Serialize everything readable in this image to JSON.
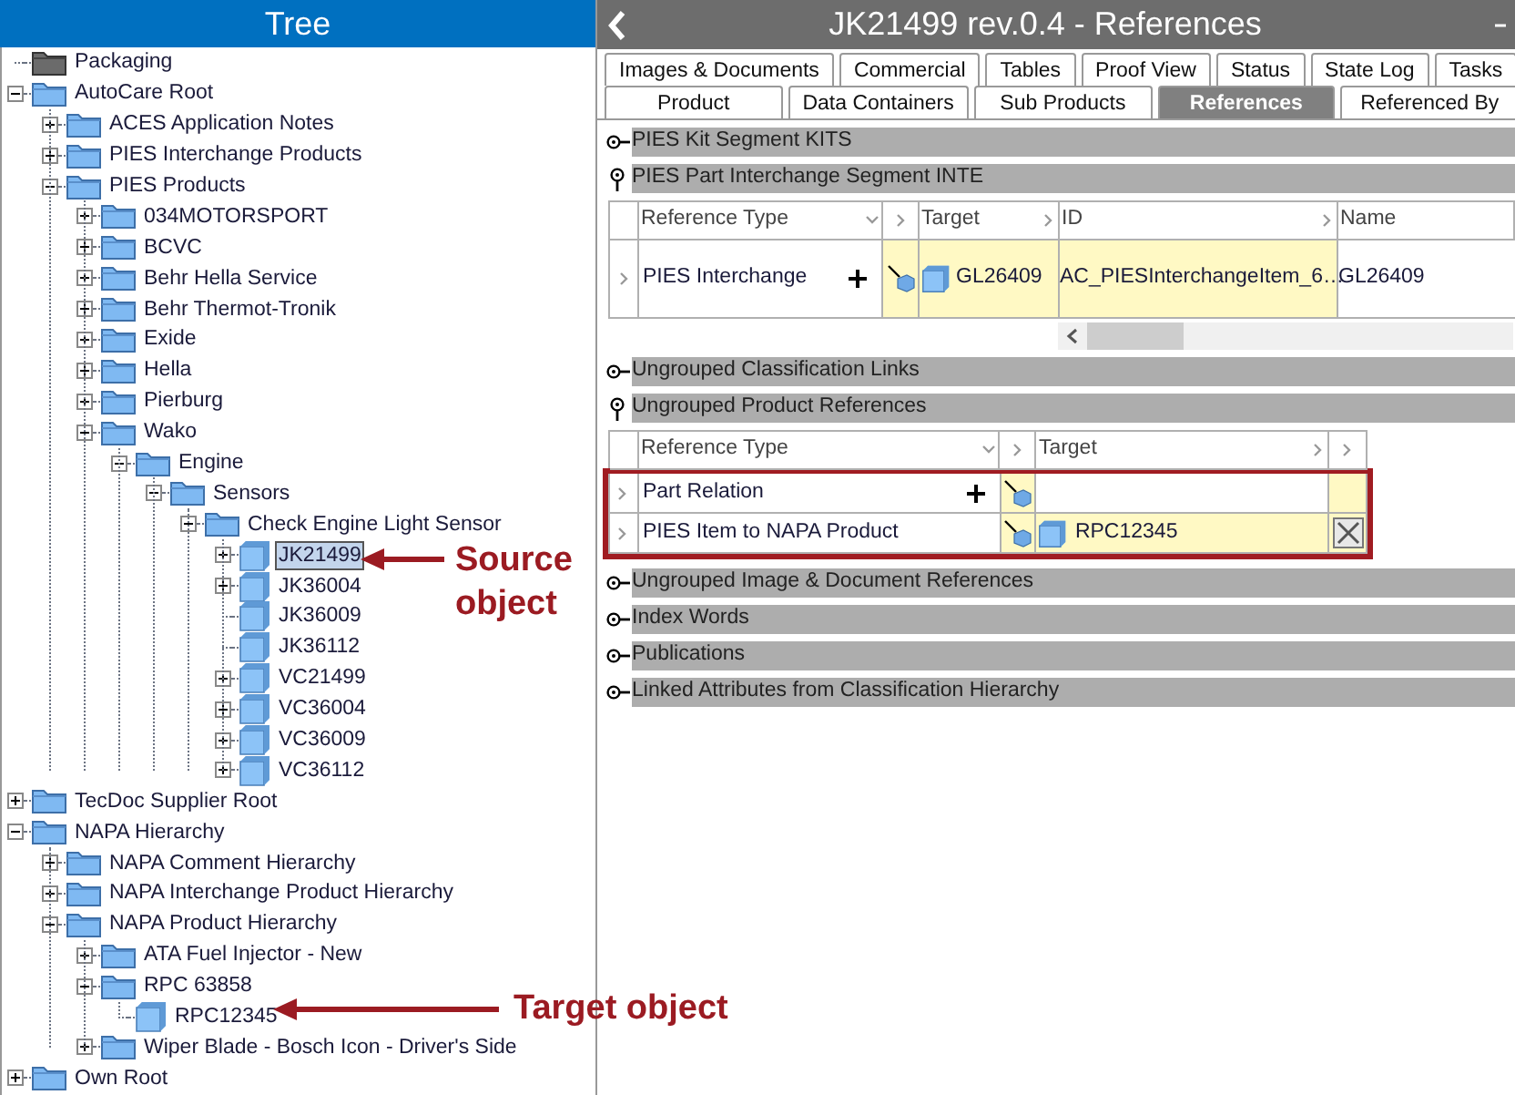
{
  "tree": {
    "title": "Tree",
    "items": [
      {
        "label": "Packaging",
        "kind": "folder-dark"
      },
      {
        "label": "AutoCare Root",
        "kind": "folder",
        "expanded": true,
        "children": [
          {
            "label": "ACES Application Notes",
            "kind": "folder",
            "expanded": false
          },
          {
            "label": "PIES Interchange Products",
            "kind": "folder",
            "expanded": false
          },
          {
            "label": "PIES Products",
            "kind": "folder",
            "expanded": true,
            "children": [
              {
                "label": "034MOTORSPORT",
                "kind": "folder",
                "expanded": false
              },
              {
                "label": "BCVC",
                "kind": "folder",
                "expanded": false
              },
              {
                "label": "Behr Hella Service",
                "kind": "folder",
                "expanded": false
              },
              {
                "label": "Behr Thermot-Tronik",
                "kind": "folder",
                "expanded": false
              },
              {
                "label": "Exide",
                "kind": "folder",
                "expanded": false
              },
              {
                "label": "Hella",
                "kind": "folder",
                "expanded": false
              },
              {
                "label": "Pierburg",
                "kind": "folder",
                "expanded": false
              },
              {
                "label": "Wako",
                "kind": "folder",
                "expanded": true,
                "children": [
                  {
                    "label": "Engine",
                    "kind": "folder",
                    "expanded": true,
                    "children": [
                      {
                        "label": "Sensors",
                        "kind": "folder",
                        "expanded": true,
                        "children": [
                          {
                            "label": "Check Engine Light Sensor",
                            "kind": "folder",
                            "expanded": true,
                            "children": [
                              {
                                "label": "JK21499",
                                "kind": "product",
                                "expanded": false,
                                "selected": true
                              },
                              {
                                "label": "JK36004",
                                "kind": "product",
                                "expanded": false,
                                "selected": false
                              },
                              {
                                "label": "JK36009",
                                "kind": "product",
                                "selected": false
                              },
                              {
                                "label": "JK36112",
                                "kind": "product",
                                "selected": false
                              },
                              {
                                "label": "VC21499",
                                "kind": "product",
                                "expanded": false,
                                "selected": false
                              },
                              {
                                "label": "VC36004",
                                "kind": "product",
                                "expanded": false,
                                "selected": false
                              },
                              {
                                "label": "VC36009",
                                "kind": "product",
                                "expanded": false,
                                "selected": false
                              },
                              {
                                "label": "VC36112",
                                "kind": "product",
                                "expanded": false,
                                "selected": false
                              }
                            ]
                          }
                        ]
                      }
                    ]
                  }
                ]
              }
            ]
          }
        ]
      },
      {
        "label": "TecDoc Supplier Root",
        "kind": "folder",
        "expanded": false
      },
      {
        "label": "NAPA Hierarchy",
        "kind": "folder",
        "expanded": true,
        "children": [
          {
            "label": "NAPA Comment Hierarchy",
            "kind": "folder",
            "expanded": false
          },
          {
            "label": "NAPA Interchange Product Hierarchy",
            "kind": "folder",
            "expanded": false
          },
          {
            "label": "NAPA Product Hierarchy",
            "kind": "folder",
            "expanded": true,
            "children": [
              {
                "label": "ATA Fuel Injector - New",
                "kind": "folder",
                "expanded": false
              },
              {
                "label": "RPC 63858",
                "kind": "folder",
                "expanded": true,
                "children": [
                  {
                    "label": "RPC12345",
                    "kind": "product",
                    "selected": false
                  }
                ]
              },
              {
                "label": "Wiper Blade - Bosch Icon - Driver's Side",
                "kind": "folder",
                "expanded": false
              }
            ]
          }
        ]
      },
      {
        "label": "Own Root",
        "kind": "folder",
        "expanded": false
      }
    ]
  },
  "annotations": [
    {
      "line1": "Source",
      "line2": "object",
      "kind": "source"
    },
    {
      "line1": "Target object",
      "kind": "target"
    }
  ],
  "editor": {
    "title": "JK21499 rev.0.4 - References",
    "tab_rows": [
      [
        {
          "label": "Images & Documents",
          "selected": false
        },
        {
          "label": "Commercial",
          "selected": false
        },
        {
          "label": "Tables",
          "selected": false
        },
        {
          "label": "Proof View",
          "selected": false
        },
        {
          "label": "Status",
          "selected": false
        },
        {
          "label": "State Log",
          "selected": false
        },
        {
          "label": "Tasks",
          "selected": false
        }
      ],
      [
        {
          "label": "Product",
          "selected": false
        },
        {
          "label": "Data Containers",
          "selected": false
        },
        {
          "label": "Sub Products",
          "selected": false
        },
        {
          "label": "References",
          "selected": true
        },
        {
          "label": "Referenced By",
          "selected": false
        }
      ]
    ],
    "sections": [
      {
        "title": "PIES Kit Segment KITS",
        "expanded": false
      },
      {
        "title": "PIES Part Interchange Segment INTE",
        "expanded": true,
        "table": {
          "kind": "interchange",
          "columns": [
            "Reference Type",
            "Target",
            "ID",
            "Name"
          ],
          "rows": [
            {
              "reference_type": "PIES Interchange",
              "target": "GL26409",
              "id": "AC_PIESInterchangeItem_6…",
              "name": "GL26409"
            }
          ]
        }
      },
      {
        "title": "Ungrouped Classification Links",
        "expanded": false
      },
      {
        "title": "Ungrouped Product References",
        "expanded": true,
        "table": {
          "kind": "product",
          "highlighted": true,
          "columns": [
            "Reference Type",
            "Target"
          ],
          "rows": [
            {
              "reference_type": "Part Relation",
              "add": true
            },
            {
              "reference_type": "PIES Item to NAPA Product",
              "target": "RPC12345",
              "removable": true
            }
          ]
        }
      },
      {
        "title": "Ungrouped Image & Document References",
        "expanded": false
      },
      {
        "title": "Index Words",
        "expanded": false
      },
      {
        "title": "Publications",
        "expanded": false
      },
      {
        "title": "Linked Attributes from Classification Hierarchy",
        "expanded": false
      }
    ]
  }
}
